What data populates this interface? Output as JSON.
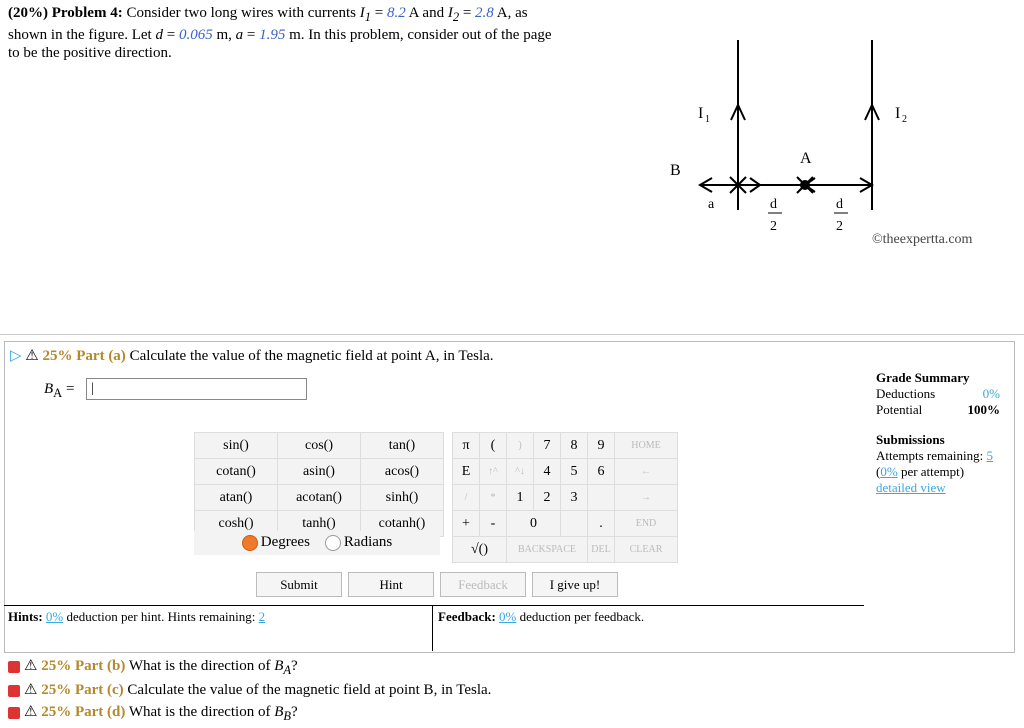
{
  "problem": {
    "header": "(20%) Problem 4:",
    "text1": "Consider two long wires with currents",
    "I1_label": "I",
    "I1_val": "8.2",
    "I2_val": "2.8",
    "unit_A": "A, as",
    "text2": "shown in the figure. Let",
    "d_val": "0.065",
    "a_val": "1.95",
    "text3": "m. In this problem, consider out of the page",
    "text4": "to be the positive direction."
  },
  "figure": {
    "I1": "I",
    "I2": "I",
    "B": "B",
    "A": "A",
    "a": "a",
    "d": "d",
    "two": "2"
  },
  "copyright": "©theexpertta.com",
  "part_a": {
    "percent": "25% Part (a)",
    "text": "Calculate the value of the magnetic field at point A, in Tesla.",
    "label": "B",
    "sub": "A",
    "eq": "=",
    "input_value": "|"
  },
  "calc": {
    "funcs": [
      [
        "sin()",
        "cos()",
        "tan()"
      ],
      [
        "cotan()",
        "asin()",
        "acos()"
      ],
      [
        "atan()",
        "acotan()",
        "sinh()"
      ],
      [
        "cosh()",
        "tanh()",
        "cotanh()"
      ]
    ],
    "degrees": "Degrees",
    "radians": "Radians",
    "home": "HOME",
    "end": "END",
    "backspace": "BACKSPACE",
    "del": "DEL",
    "clear": "CLEAR"
  },
  "grade": {
    "title": "Grade Summary",
    "deductions_label": "Deductions",
    "deductions_val": "0%",
    "potential_label": "Potential",
    "potential_val": "100%",
    "submissions": "Submissions",
    "attempts": "Attempts remaining:",
    "attempts_val": "5",
    "per_attempt_pct": "0%",
    "per_attempt": "per attempt)",
    "detailed": "detailed view"
  },
  "buttons": {
    "submit": "Submit",
    "hint": "Hint",
    "feedback": "Feedback",
    "give_up": "I give up!"
  },
  "hints": {
    "label": "Hints:",
    "pct": "0%",
    "text": "deduction per hint. Hints remaining:",
    "remaining": "2"
  },
  "feedback": {
    "label": "Feedback:",
    "pct": "0%",
    "text": "deduction per feedback."
  },
  "parts": [
    {
      "pct": "25% Part (b)",
      "text": "What is the direction of"
    },
    {
      "pct": "25% Part (c)",
      "text": "Calculate the value of the magnetic field at point B, in Tesla."
    },
    {
      "pct": "25% Part (d)",
      "text": "What is the direction of"
    }
  ]
}
